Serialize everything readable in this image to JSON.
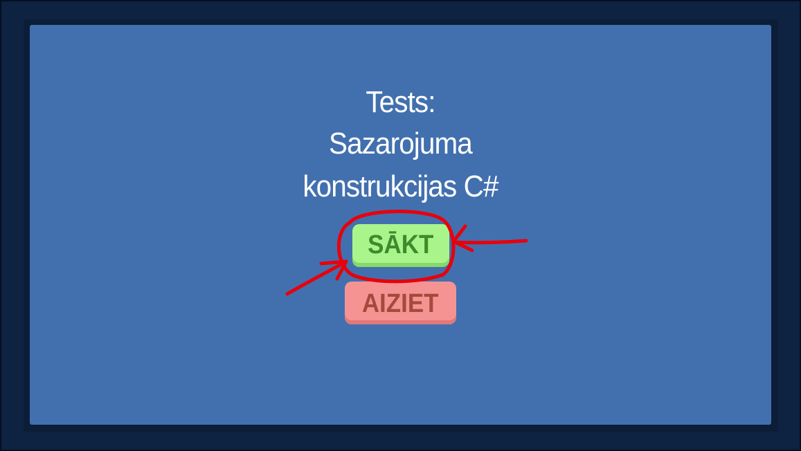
{
  "screen": {
    "title_lines": [
      "Tests:",
      "Sazarojuma",
      "konstrukcijas C#"
    ]
  },
  "buttons": {
    "start_label": "SĀKT",
    "exit_label": "AIZIET"
  },
  "colors": {
    "background_outer": "#0e2241",
    "panel": "#4270ae",
    "start_button": "#a9f58b",
    "start_text": "#3f8a2b",
    "exit_button": "#f59393",
    "exit_text": "#a44a3c",
    "annotation": "#e8000b"
  }
}
